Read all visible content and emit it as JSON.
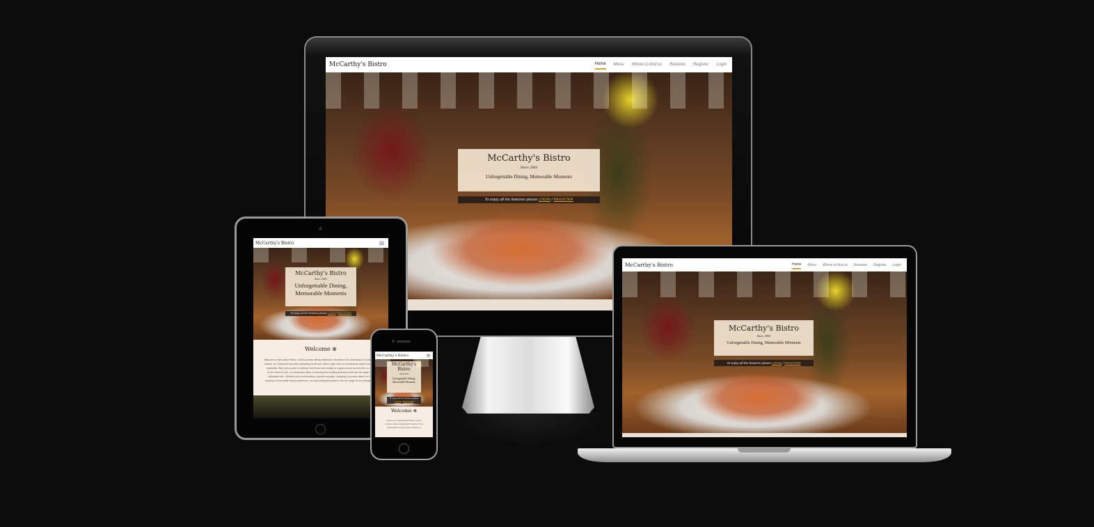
{
  "site": {
    "brand": "McCarthy's Bistro",
    "nav": [
      "Home",
      "Menu",
      "Where to find us",
      "Reviews",
      "Register",
      "Login"
    ],
    "hero": {
      "title": "McCarthy's Bistro",
      "since": "Since 2003",
      "tagline": "Unforgettable Dining, Memorable Moments",
      "tagline_tablet": "Unforgettable Dining,\nMemorable Moments",
      "cta_prefix": "To enjoy all the features please",
      "cta_login": "LOGIN",
      "cta_sep": "/",
      "cta_register": "REGISTER"
    },
    "welcome": {
      "title": "Welcome",
      "icon": "globe-icon",
      "lines": [
        "Welcome to McCarthy's Bistro, Cork's premier dining destination! Nestled in the picturesque County Cork,",
        "Ireland, our restaurant has been delighting locals and visitors alike with our exceptional cuisine and warm",
        "hospitality. Step into a world of culinary excellence and indulge in a gastronomic journey like no other.",
        "In the heart of Cork, our restaurant offers a charming and inviting ambiance that sets the stage for a",
        "delectable fare. Whether you're celebrating a special occasion, enjoying a romantic dinner for two,",
        "seeking a memorable dining experience, our welcoming atmosphere sets the stage for an unforgettable"
      ],
      "phone_lines": [
        "Welcome to McCarthy's Bistro, Cork's",
        "premier dining destination! Nestled in the",
        "picturesque County Cork, Ireland our"
      ]
    }
  },
  "colors": {
    "background": "#0b0b0b",
    "accent": "#d8a23b",
    "card": "#f5e9d6",
    "link": "#e6a63a"
  }
}
